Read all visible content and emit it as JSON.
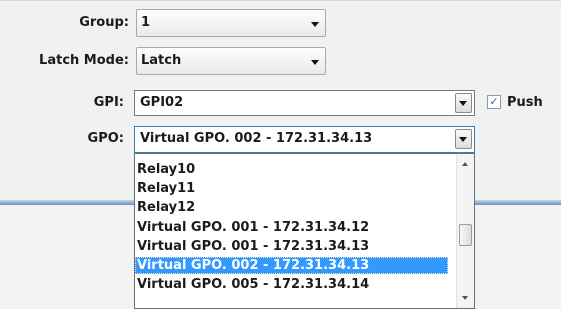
{
  "form": {
    "group_label": "Group:",
    "group_value": "1",
    "latch_label": "Latch Mode:",
    "latch_value": "Latch",
    "gpi_label": "GPI:",
    "gpi_value": "GPI02",
    "push_label": "Push",
    "push_checked": true,
    "gpo_label": "GPO:",
    "gpo_value": "Virtual GPO. 002 - 172.31.34.13"
  },
  "dropdown": {
    "items": [
      "Relay10",
      "Relay11",
      "Relay12",
      "Virtual GPO. 001 - 172.31.34.12",
      "Virtual GPO. 001 - 172.31.34.13",
      "Virtual GPO. 002 - 172.31.34.13",
      "Virtual GPO. 005 - 172.31.34.14"
    ],
    "selected_index": 5
  },
  "colors": {
    "selection": "#3399ff",
    "separator": "#6c8fb8"
  }
}
